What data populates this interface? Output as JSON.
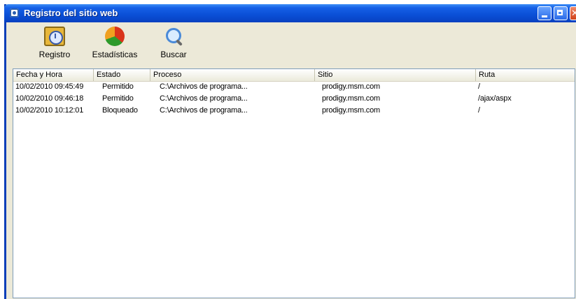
{
  "window": {
    "title": "Registro del sitio web"
  },
  "toolbar": {
    "registro_label": "Registro",
    "stats_label": "Estadísticas",
    "buscar_label": "Buscar"
  },
  "table": {
    "columns": [
      "Fecha y Hora",
      "Estado",
      "Proceso",
      "Sitio",
      "Ruta"
    ],
    "rows": [
      [
        "10/02/2010 09:45:49",
        "Permitido",
        "C:\\Archivos de programa...",
        "prodigy.msm.com",
        "/"
      ],
      [
        "10/02/2010 09:46:18",
        "Permitido",
        "C:\\Archivos de programa...",
        "prodigy.msm.com",
        "/ajax/aspx"
      ],
      [
        "10/02/2010 10:12:01",
        "Bloqueado",
        "C:\\Archivos de programa...",
        "prodigy.msm.com",
        "/"
      ]
    ]
  },
  "colors": {
    "titlebar": "#0a4fd6",
    "window_bg": "#ece9d8"
  }
}
